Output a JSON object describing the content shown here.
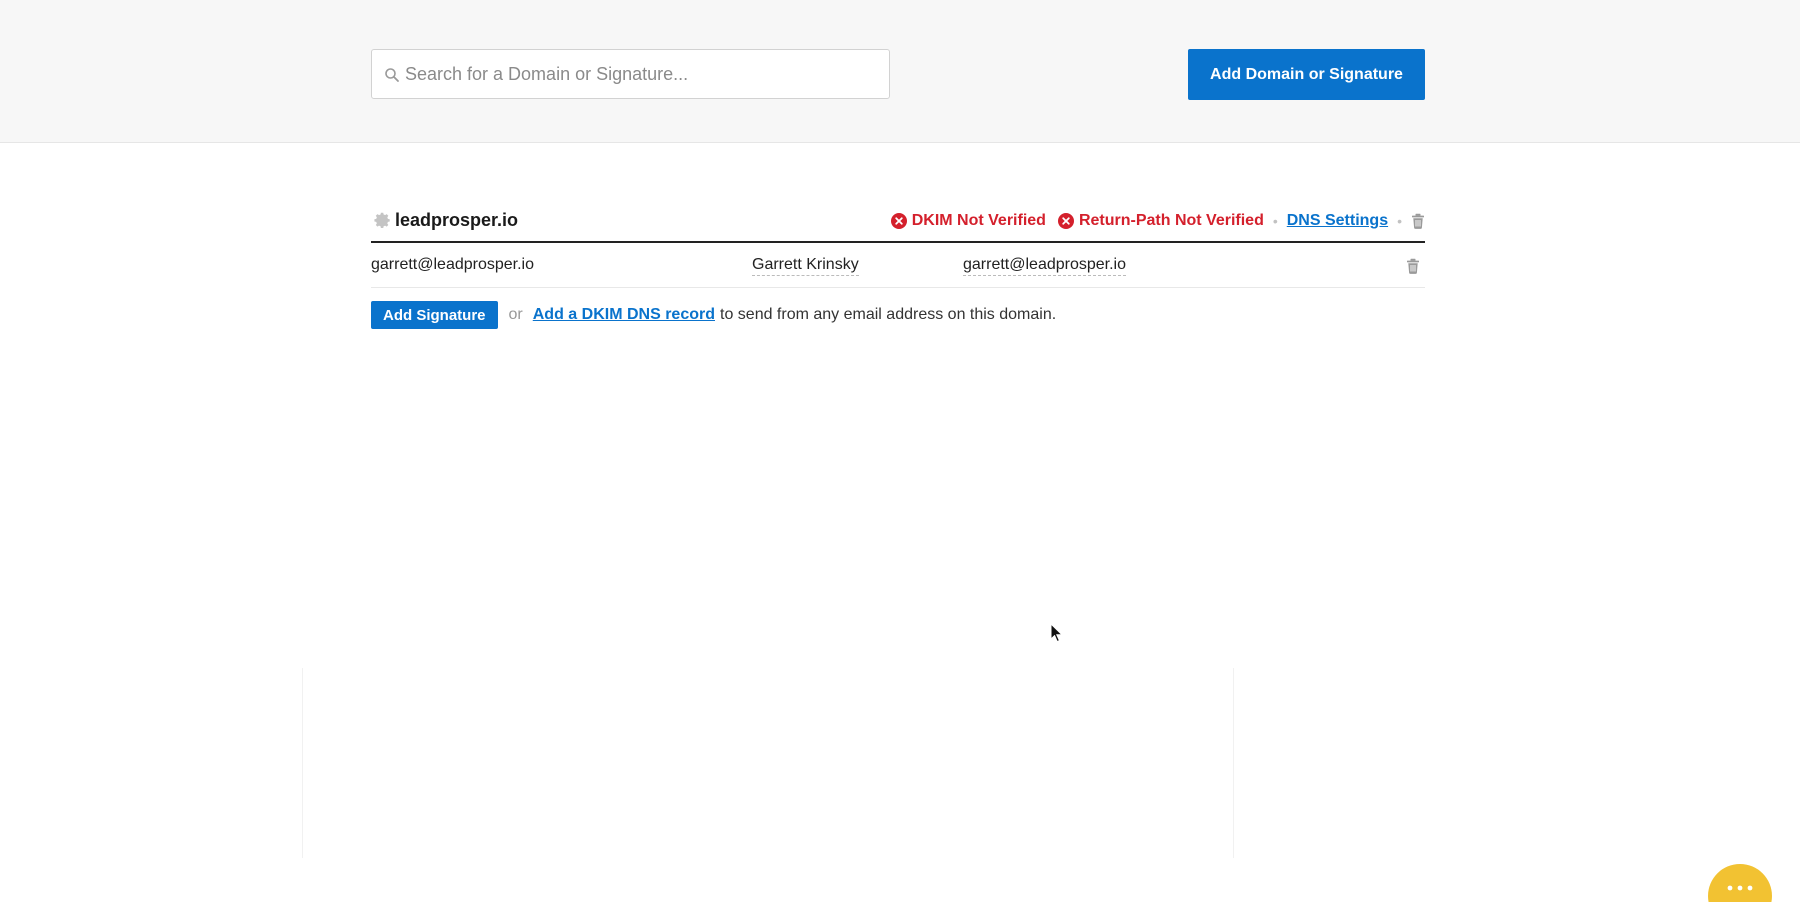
{
  "search": {
    "placeholder": "Search for a Domain or Signature..."
  },
  "header": {
    "add_button_label": "Add Domain or Signature"
  },
  "domain": {
    "name": "leadprosper.io",
    "statuses": [
      {
        "label": "DKIM Not Verified",
        "color": "#d4202c"
      },
      {
        "label": "Return-Path Not Verified",
        "color": "#d4202c"
      }
    ],
    "dns_settings_label": "DNS Settings",
    "signatures": [
      {
        "email": "garrett@leadprosper.io",
        "name": "Garrett Krinsky",
        "reply_to": "garrett@leadprosper.io"
      }
    ],
    "add_signature_label": "Add Signature",
    "or_text": "or",
    "dkim_link_label": "Add a DKIM DNS record",
    "dkim_suffix": "to send from any email address on this domain."
  },
  "colors": {
    "accent": "#0a73cc",
    "error": "#d4202c",
    "chat": "#f2c232"
  },
  "icons": [
    "search-icon",
    "gear-icon",
    "x-circle-icon",
    "trash-icon",
    "chat-icon"
  ]
}
